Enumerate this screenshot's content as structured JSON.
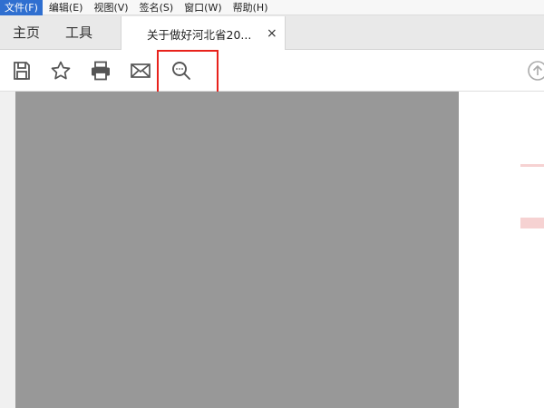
{
  "menubar": {
    "items": [
      {
        "label": "文件(F)",
        "active": true
      },
      {
        "label": "编辑(E)",
        "active": false
      },
      {
        "label": "视图(V)",
        "active": false
      },
      {
        "label": "签名(S)",
        "active": false
      },
      {
        "label": "窗口(W)",
        "active": false
      },
      {
        "label": "帮助(H)",
        "active": false
      }
    ]
  },
  "tabs": {
    "home_label": "主页",
    "tools_label": "工具",
    "document_title": "关于做好河北省20...",
    "close_glyph": "×"
  },
  "toolbar": {
    "tools": [
      "save-icon",
      "bookmark-star-icon",
      "print-icon",
      "email-icon",
      "search-more-icon"
    ],
    "highlighted_tool": "search-more-icon",
    "highlight_color": "#e8221c"
  },
  "colors": {
    "page_gray": "#989898",
    "menu_active": "#2f6fd0",
    "icon": "#555555"
  }
}
